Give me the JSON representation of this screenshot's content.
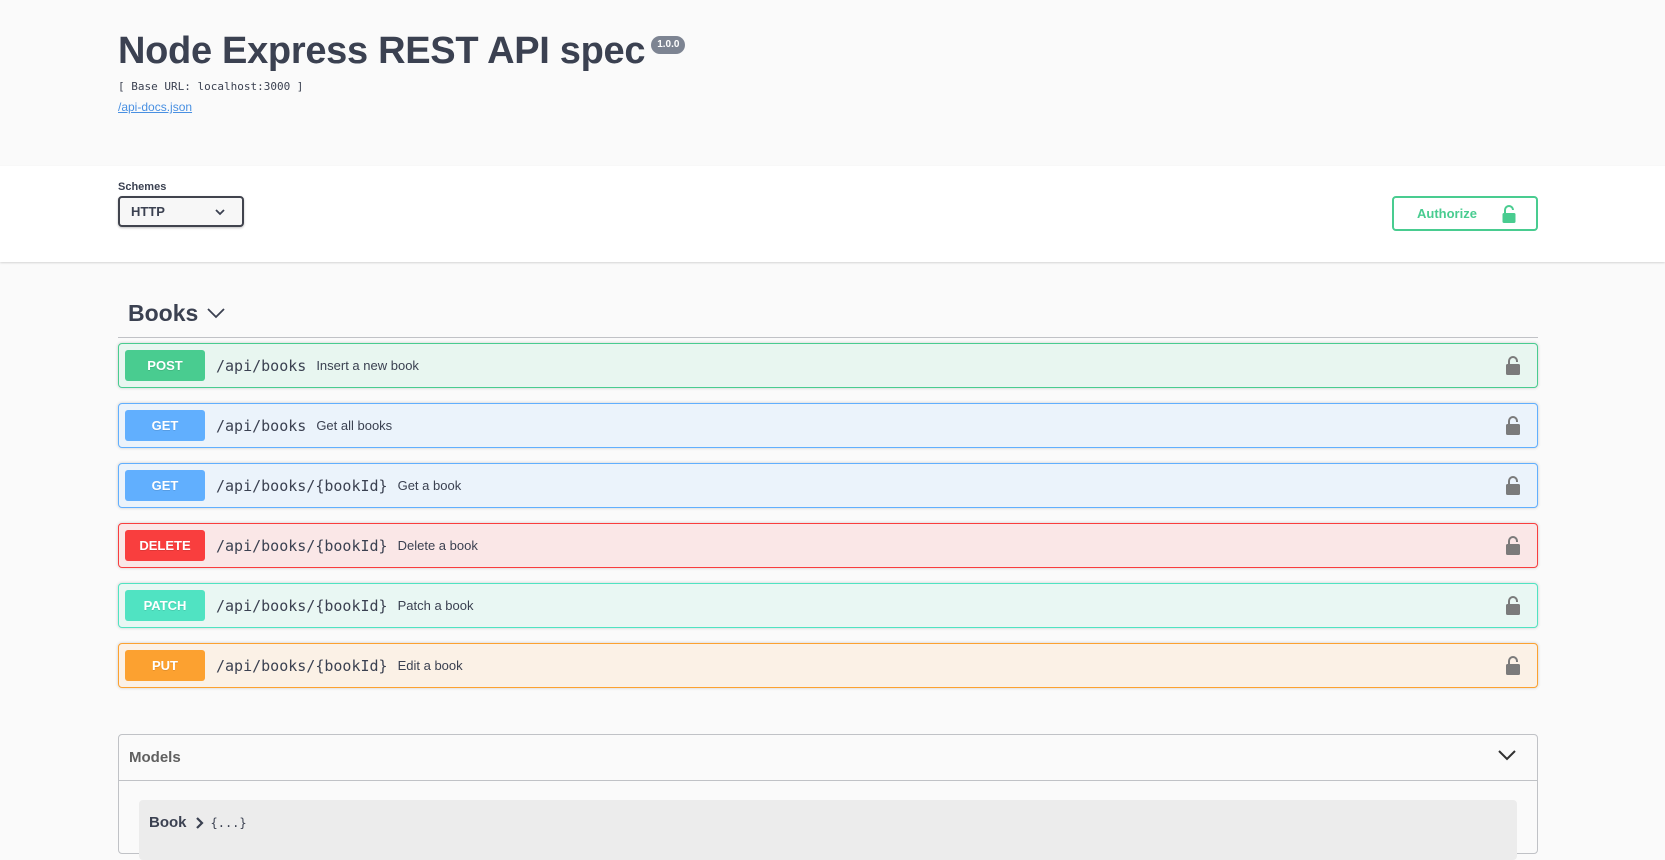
{
  "info": {
    "title": "Node Express REST API spec",
    "version": "1.0.0",
    "base_url": "[ Base URL: localhost:3000 ]",
    "docs_link": "/api-docs.json"
  },
  "schemes": {
    "label": "Schemes",
    "selected": "HTTP"
  },
  "authorize": {
    "label": "Authorize"
  },
  "tag": {
    "name": "Books"
  },
  "operations": [
    {
      "method": "POST",
      "path": "/api/books",
      "summary": "Insert a new book",
      "color": "#49cc90",
      "bg": "#e8f6f0"
    },
    {
      "method": "GET",
      "path": "/api/books",
      "summary": "Get all books",
      "color": "#61affe",
      "bg": "#ebf3fb"
    },
    {
      "method": "GET",
      "path": "/api/books/{bookId}",
      "summary": "Get a book",
      "color": "#61affe",
      "bg": "#ebf3fb"
    },
    {
      "method": "DELETE",
      "path": "/api/books/{bookId}",
      "summary": "Delete a book",
      "color": "#f93e3e",
      "bg": "#fae7e7"
    },
    {
      "method": "PATCH",
      "path": "/api/books/{bookId}",
      "summary": "Patch a book",
      "color": "#50e3c2",
      "bg": "#e9f7f3"
    },
    {
      "method": "PUT",
      "path": "/api/books/{bookId}",
      "summary": "Edit a book",
      "color": "#fca130",
      "bg": "#fbf1e6"
    }
  ],
  "models": {
    "title": "Models",
    "items": [
      {
        "name": "Book",
        "collapsed": "{...}"
      }
    ]
  },
  "icons": {
    "lock": "lock-icon",
    "chevron": "chevron-down-icon",
    "arrow": "chevron-right-icon"
  }
}
